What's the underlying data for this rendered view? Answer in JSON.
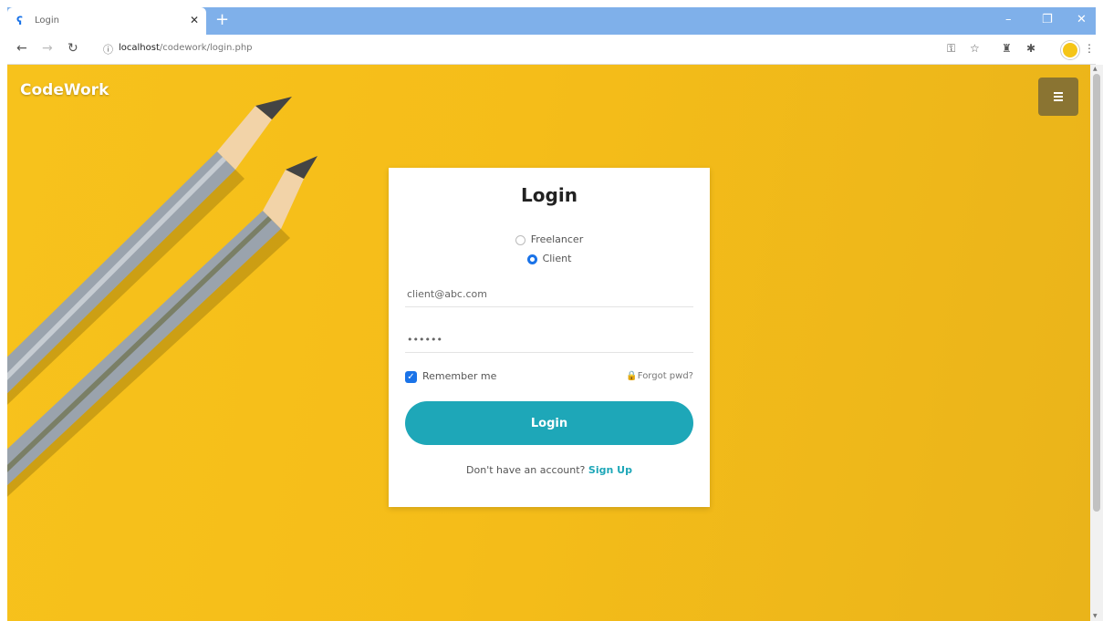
{
  "browser": {
    "tab_title": "Login",
    "url_host": "localhost",
    "url_path": "/codework/login.php"
  },
  "page": {
    "brand": "CodeWork"
  },
  "login_card": {
    "title": "Login",
    "role_options": [
      "Freelancer",
      "Client"
    ],
    "selected_role": "Client",
    "email_value": "client@abc.com",
    "password_value": "••••••",
    "remember_label": "Remember me",
    "remember_checked": true,
    "forgot_label": "Forgot pwd?",
    "submit_label": "Login",
    "signup_prompt": "Don't have an account?",
    "signup_link": "Sign Up"
  },
  "colors": {
    "background": "#f5bd19",
    "accent": "#1ea7b8",
    "menu_button": "#8a7432"
  }
}
